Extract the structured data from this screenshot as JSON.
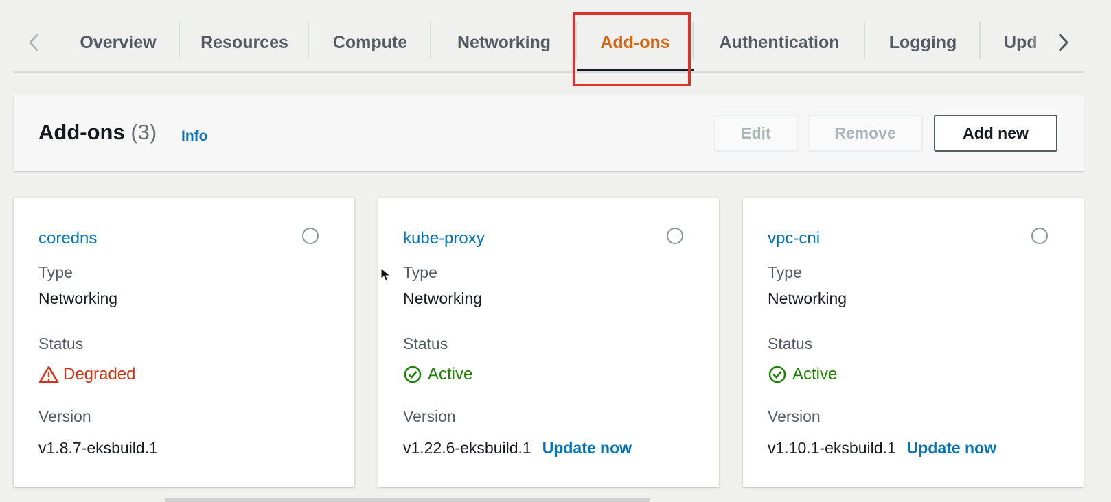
{
  "tabs": [
    {
      "label": "Overview"
    },
    {
      "label": "Resources"
    },
    {
      "label": "Compute"
    },
    {
      "label": "Networking"
    },
    {
      "label": "Add-ons",
      "active": true
    },
    {
      "label": "Authentication"
    },
    {
      "label": "Logging"
    },
    {
      "label": "Upd"
    }
  ],
  "header": {
    "title": "Add-ons",
    "count": "(3)",
    "info": "Info",
    "buttons": {
      "edit": "Edit",
      "remove": "Remove",
      "add": "Add new"
    }
  },
  "labels": {
    "type": "Type",
    "status": "Status",
    "version": "Version"
  },
  "cards": [
    {
      "name": "coredns",
      "type": "Networking",
      "status": "Degraded",
      "version": "v1.8.7-eksbuild.1",
      "update": ""
    },
    {
      "name": "kube-proxy",
      "type": "Networking",
      "status": "Active",
      "version": "v1.22.6-eksbuild.1",
      "update": "Update now"
    },
    {
      "name": "vpc-cni",
      "type": "Networking",
      "status": "Active",
      "version": "v1.10.1-eksbuild.1",
      "update": "Update now"
    }
  ],
  "colors": {
    "active_tab": "#d86613",
    "link": "#0073bb",
    "degraded": "#d13212",
    "active": "#1d8102",
    "highlight": "#e0302b"
  },
  "icons": [
    "chevron-left-icon",
    "chevron-right-icon",
    "warning-icon",
    "check-circle-icon",
    "mouse-pointer-icon"
  ]
}
